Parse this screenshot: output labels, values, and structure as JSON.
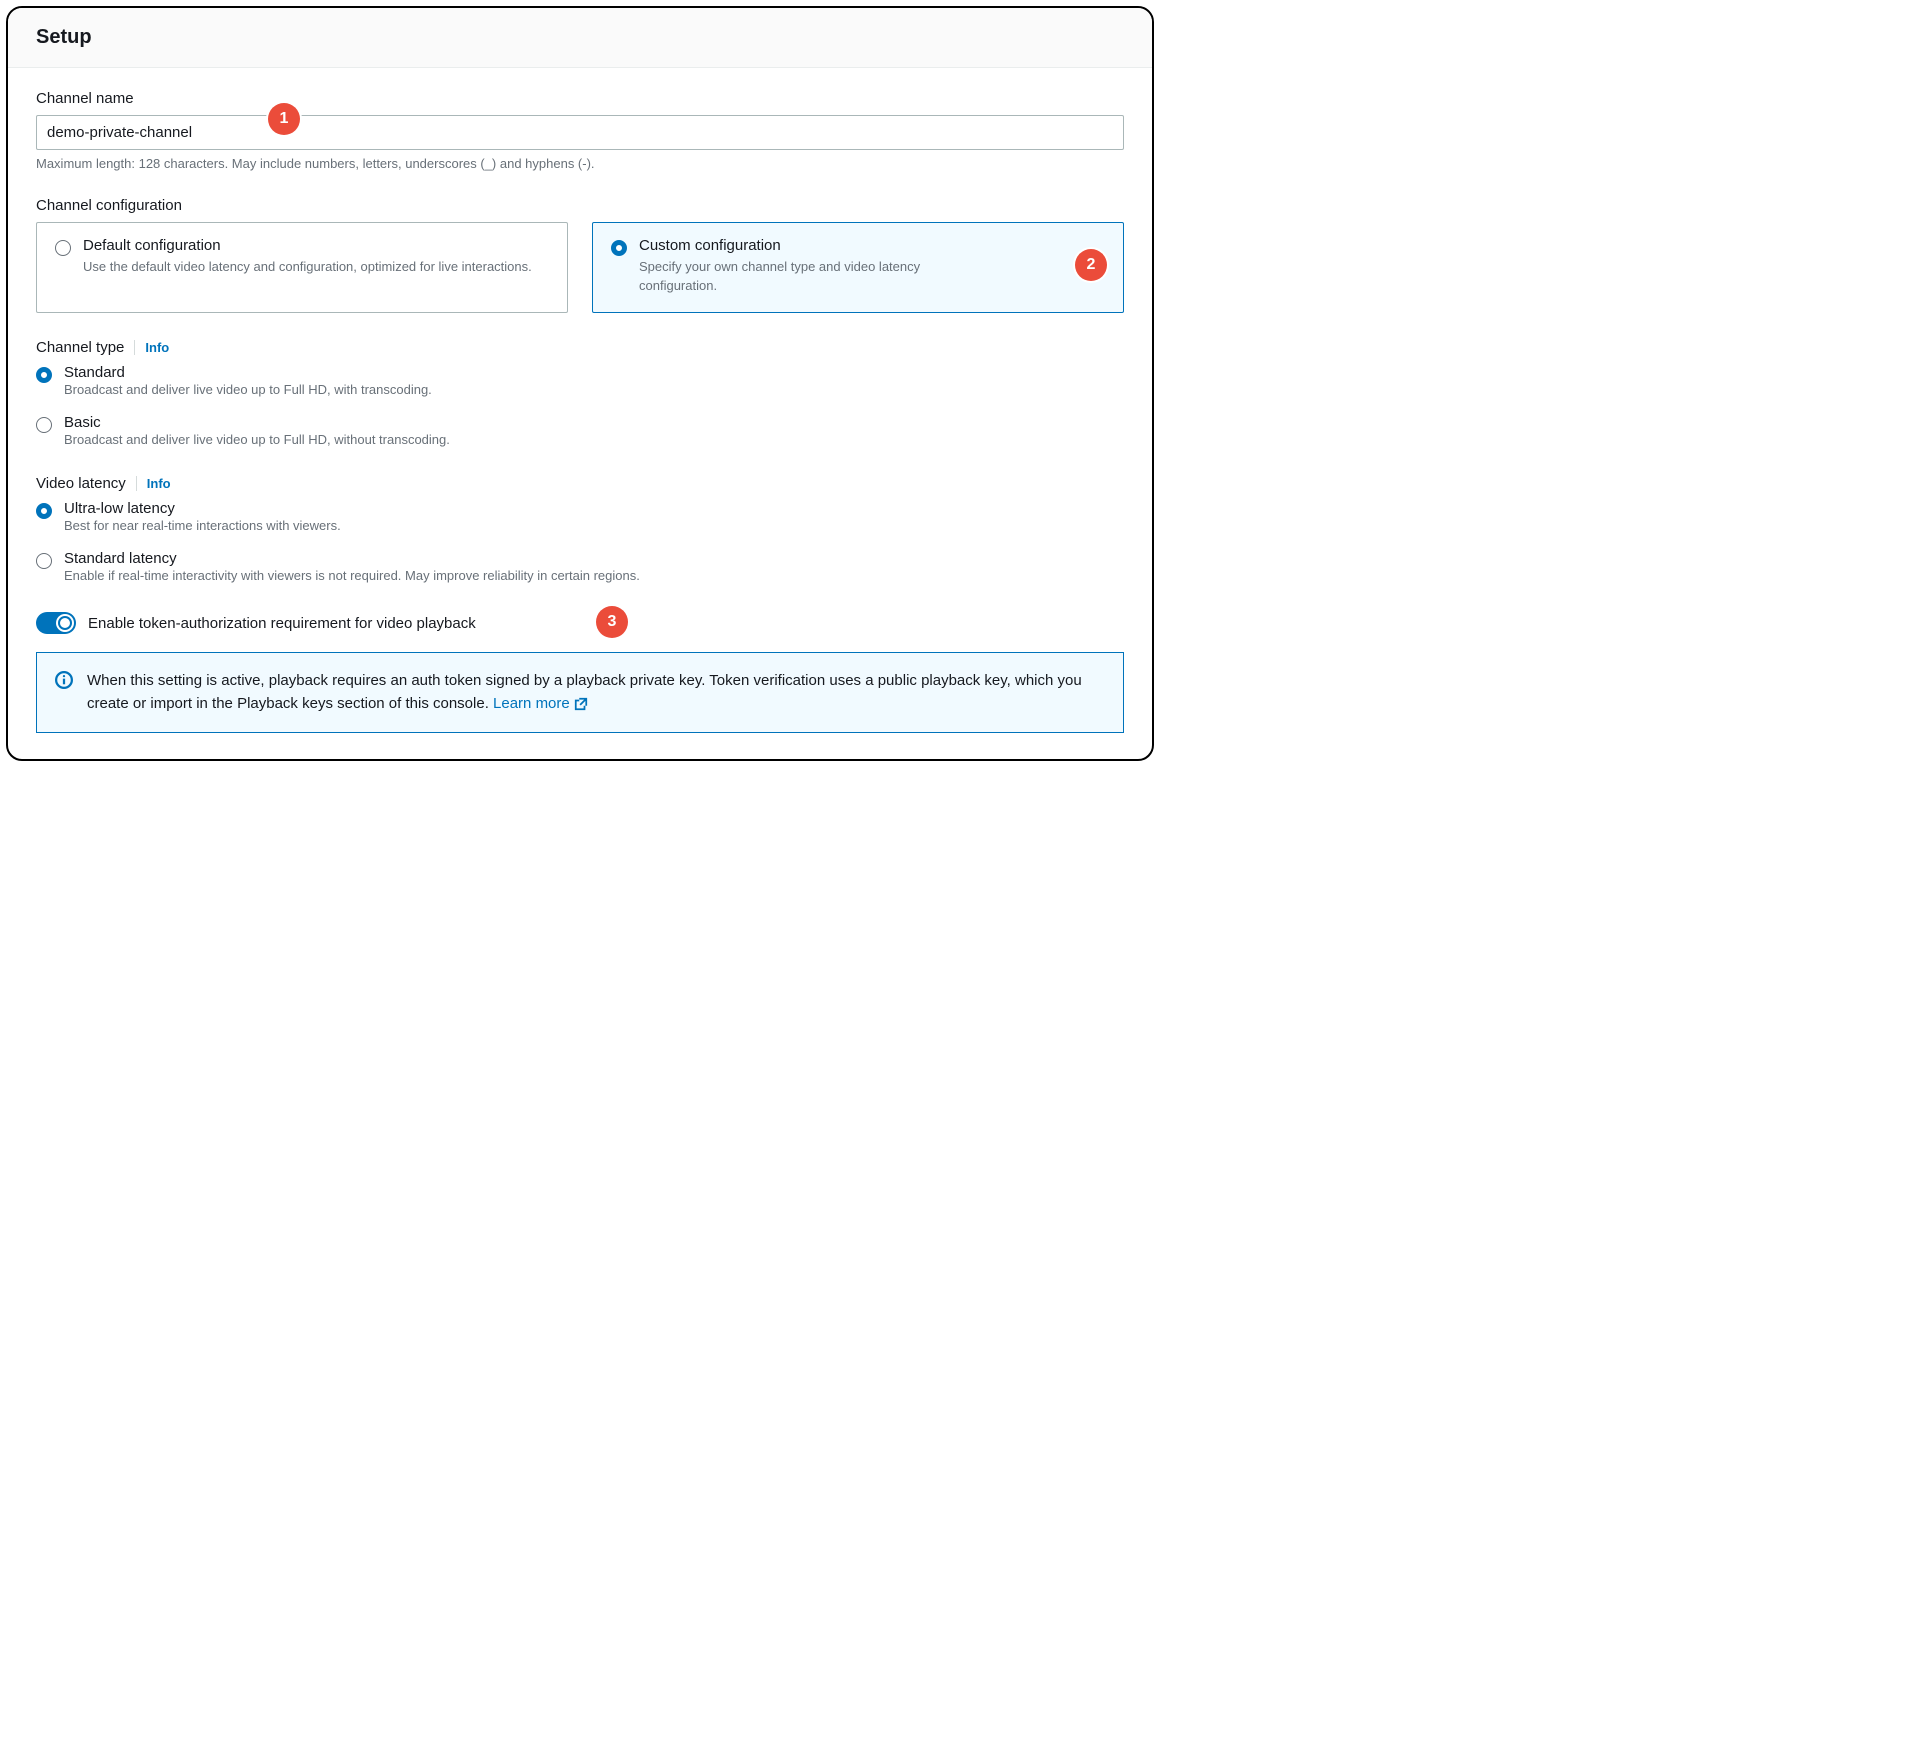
{
  "header": {
    "title": "Setup"
  },
  "callouts": {
    "c1": "1",
    "c2": "2",
    "c3": "3"
  },
  "channel_name": {
    "label": "Channel name",
    "value": "demo-private-channel",
    "hint": "Maximum length: 128 characters. May include numbers, letters, underscores (_) and hyphens (-)."
  },
  "channel_config": {
    "label": "Channel configuration",
    "options": [
      {
        "title": "Default configuration",
        "desc": "Use the default video latency and configuration, optimized for live interactions.",
        "selected": false
      },
      {
        "title": "Custom configuration",
        "desc": "Specify your own channel type and video latency configuration.",
        "selected": true
      }
    ]
  },
  "channel_type": {
    "label": "Channel type",
    "info": "Info",
    "options": [
      {
        "title": "Standard",
        "desc": "Broadcast and deliver live video up to Full HD, with transcoding.",
        "selected": true
      },
      {
        "title": "Basic",
        "desc": "Broadcast and deliver live video up to Full HD, without transcoding.",
        "selected": false
      }
    ]
  },
  "video_latency": {
    "label": "Video latency",
    "info": "Info",
    "options": [
      {
        "title": "Ultra-low latency",
        "desc": "Best for near real-time interactions with viewers.",
        "selected": true
      },
      {
        "title": "Standard latency",
        "desc": "Enable if real-time interactivity with viewers is not required. May improve reliability in certain regions.",
        "selected": false
      }
    ]
  },
  "token_auth": {
    "label": "Enable token-authorization requirement for video playback",
    "enabled": true,
    "info_text": "When this setting is active, playback requires an auth token signed by a playback private key. Token verification uses a public playback key, which you create or import in the Playback keys section of this console. ",
    "learn_more": "Learn more"
  }
}
